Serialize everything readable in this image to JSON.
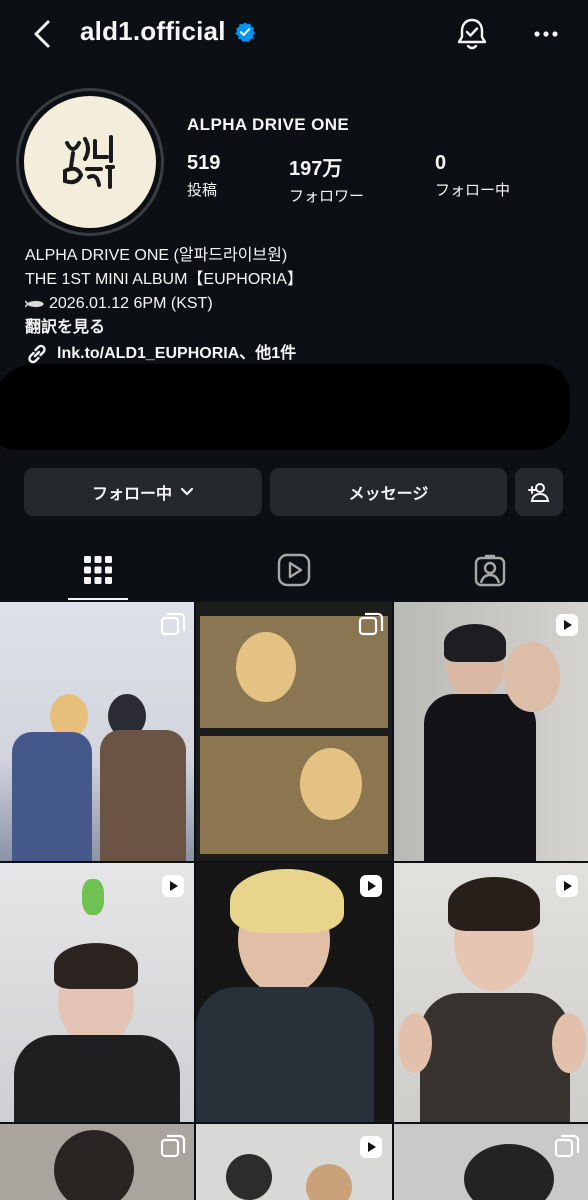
{
  "header": {
    "username": "ald1.official"
  },
  "profile": {
    "display_name": "ALPHA DRIVE ONE",
    "stats": [
      {
        "value": "519",
        "label": "投稿"
      },
      {
        "value": "197万",
        "label": "フォロワー"
      },
      {
        "value": "0",
        "label": "フォロー中"
      }
    ],
    "bio": {
      "line1": "ALPHA DRIVE ONE (알파드라이브원)",
      "line2": "THE 1ST MINI ALBUM【EUPHORIA】",
      "line3": "2026.01.12 6PM (KST)",
      "translate": "翻訳を見る",
      "link": "lnk.to/ALD1_EUPHORIA、他1件"
    }
  },
  "actions": {
    "following": "フォロー中",
    "message": "メッセージ"
  },
  "colors": {
    "background": "#0c1014",
    "button": "#25292e",
    "verified": "#0095f6"
  },
  "tabs": [
    {
      "icon": "grid-icon",
      "selected": true
    },
    {
      "icon": "reels-icon",
      "selected": false
    },
    {
      "icon": "tagged-icon",
      "selected": false
    }
  ],
  "posts": [
    {
      "type": "carousel"
    },
    {
      "type": "carousel"
    },
    {
      "type": "reel"
    },
    {
      "type": "reel"
    },
    {
      "type": "reel"
    },
    {
      "type": "reel"
    },
    {
      "type": "carousel"
    },
    {
      "type": "reel"
    },
    {
      "type": "carousel"
    }
  ]
}
